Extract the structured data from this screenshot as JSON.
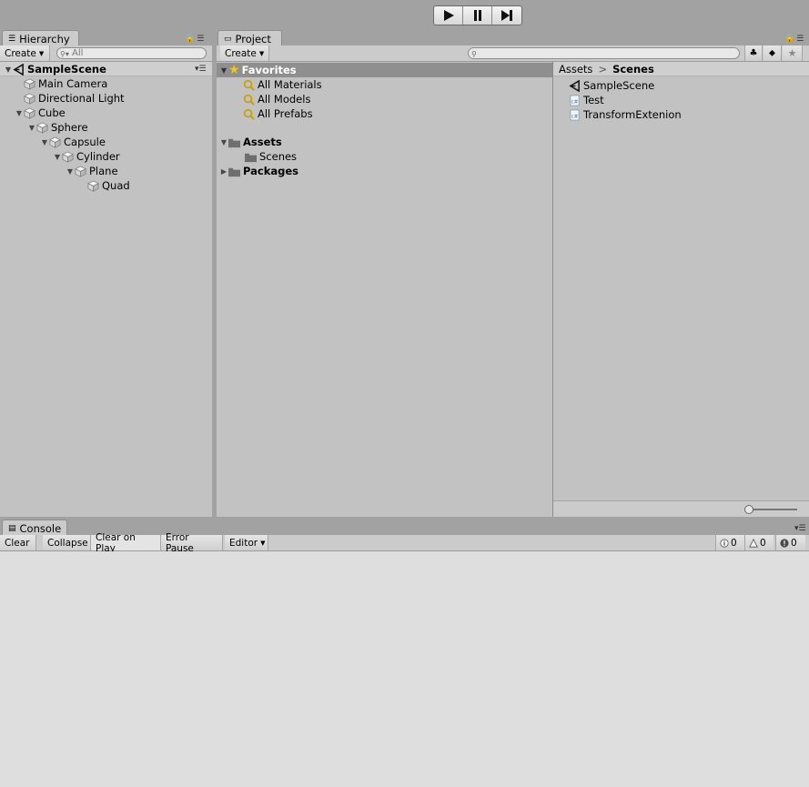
{
  "hierarchy": {
    "tab_label": "Hierarchy",
    "create_label": "Create",
    "search_placeholder": "All",
    "scene": "SampleScene",
    "items": [
      {
        "label": "Main Camera",
        "depth": 0,
        "expanded": null
      },
      {
        "label": "Directional Light",
        "depth": 0,
        "expanded": null
      },
      {
        "label": "Cube",
        "depth": 0,
        "expanded": true
      },
      {
        "label": "Sphere",
        "depth": 1,
        "expanded": true
      },
      {
        "label": "Capsule",
        "depth": 2,
        "expanded": true
      },
      {
        "label": "Cylinder",
        "depth": 3,
        "expanded": true
      },
      {
        "label": "Plane",
        "depth": 4,
        "expanded": true
      },
      {
        "label": "Quad",
        "depth": 5,
        "expanded": null
      }
    ]
  },
  "project": {
    "tab_label": "Project",
    "create_label": "Create",
    "favorites": {
      "label": "Favorites",
      "items": [
        "All Materials",
        "All Models",
        "All Prefabs"
      ]
    },
    "assets": {
      "label": "Assets",
      "children": [
        "Scenes"
      ]
    },
    "packages": {
      "label": "Packages"
    },
    "breadcrumb": {
      "root": "Assets",
      "current": "Scenes"
    },
    "files": [
      {
        "name": "SampleScene",
        "icon": "unity-scene-icon"
      },
      {
        "name": "Test",
        "icon": "csharp-script-icon"
      },
      {
        "name": "TransformExtenion",
        "icon": "csharp-script-icon"
      }
    ]
  },
  "console": {
    "tab_label": "Console",
    "buttons": {
      "clear": "Clear",
      "collapse": "Collapse",
      "clear_on_play": "Clear on Play",
      "error_pause": "Error Pause",
      "editor": "Editor"
    },
    "counts": {
      "info": "0",
      "warning": "0",
      "error": "0"
    }
  },
  "colors": {
    "window_bg": "#a2a2a2",
    "panel_bg": "#c2c2c2",
    "selection": "#8f8f8f",
    "console_bg": "#dedede"
  }
}
